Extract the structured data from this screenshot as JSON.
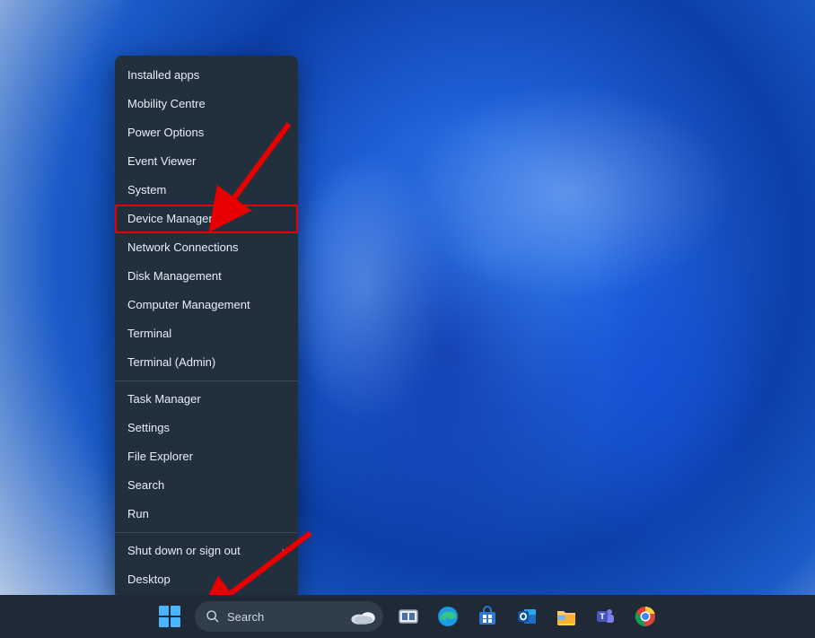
{
  "context_menu": {
    "sections": [
      [
        {
          "label": "Installed apps",
          "name": "menu-installed-apps"
        },
        {
          "label": "Mobility Centre",
          "name": "menu-mobility-centre"
        },
        {
          "label": "Power Options",
          "name": "menu-power-options"
        },
        {
          "label": "Event Viewer",
          "name": "menu-event-viewer"
        },
        {
          "label": "System",
          "name": "menu-system"
        },
        {
          "label": "Device Manager",
          "name": "menu-device-manager",
          "highlight": true
        },
        {
          "label": "Network Connections",
          "name": "menu-network-connections"
        },
        {
          "label": "Disk Management",
          "name": "menu-disk-management"
        },
        {
          "label": "Computer Management",
          "name": "menu-computer-management"
        },
        {
          "label": "Terminal",
          "name": "menu-terminal"
        },
        {
          "label": "Terminal (Admin)",
          "name": "menu-terminal-admin"
        }
      ],
      [
        {
          "label": "Task Manager",
          "name": "menu-task-manager"
        },
        {
          "label": "Settings",
          "name": "menu-settings"
        },
        {
          "label": "File Explorer",
          "name": "menu-file-explorer"
        },
        {
          "label": "Search",
          "name": "menu-search"
        },
        {
          "label": "Run",
          "name": "menu-run"
        }
      ],
      [
        {
          "label": "Shut down or sign out",
          "name": "menu-shutdown-signout",
          "submenu": true
        },
        {
          "label": "Desktop",
          "name": "menu-desktop"
        }
      ]
    ]
  },
  "taskbar": {
    "search_placeholder": "Search",
    "apps": [
      {
        "name": "taskbar-task-view",
        "title": "Task View"
      },
      {
        "name": "taskbar-edge",
        "title": "Microsoft Edge"
      },
      {
        "name": "taskbar-store",
        "title": "Microsoft Store"
      },
      {
        "name": "taskbar-outlook",
        "title": "Outlook"
      },
      {
        "name": "taskbar-file-explorer",
        "title": "File Explorer"
      },
      {
        "name": "taskbar-teams",
        "title": "Microsoft Teams"
      },
      {
        "name": "taskbar-chrome",
        "title": "Google Chrome"
      }
    ]
  }
}
